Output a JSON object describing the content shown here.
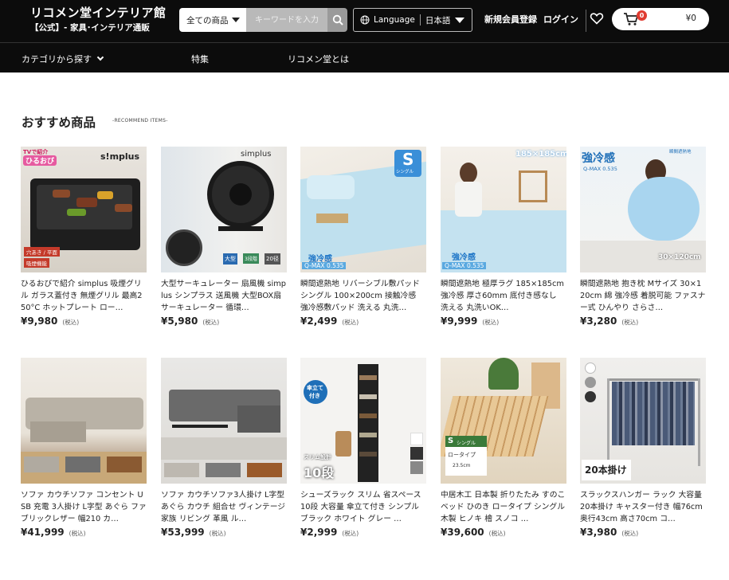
{
  "header": {
    "brand_name": "リコメン堂インテリア館",
    "brand_sub": "【公式】- 家具･インテリア通販",
    "search_category": "全ての商品",
    "search_placeholder": "キーワードを入力",
    "language_label": "Language",
    "language_value": "日本語",
    "register_label": "新規会員登録",
    "login_label": "ログイン",
    "cart_count": "0",
    "cart_amount": "¥0"
  },
  "nav": {
    "categories": "カテゴリから探す",
    "features": "特集",
    "about": "リコメン堂とは"
  },
  "section": {
    "title": "おすすめ商品",
    "subtitle": "-RECOMMEND ITEMS-"
  },
  "tax_label": "(税込)",
  "products": [
    {
      "name": "ひるおびで紹介 simplus 吸煙グリル ガラス蓋付き 無煙グリル 最高250°C ホットプレート ロー…",
      "price": "¥9,980",
      "img_texts": [
        "TVで紹介",
        "ひるおび",
        "s!mplus",
        "穴あき / 平面",
        "吸煙機能"
      ]
    },
    {
      "name": "大型サーキュレーター 扇風機 simplus シンプラス 送風機 大型BOX扇 サーキュレーター 循環…",
      "price": "¥5,980",
      "img_texts": [
        "simplus",
        "大型",
        "3段階",
        "20径"
      ]
    },
    {
      "name": "瞬間遮熱地 リバーシブル敷パッド シングル 100×200cm 接触冷感 強冷感敷パッド 洗える 丸洗…",
      "price": "¥2,499",
      "img_texts": [
        "S",
        "シングル",
        "強冷感",
        "Q-MAX 0.535"
      ]
    },
    {
      "name": "瞬間遮熱地 極厚ラグ 185×185cm 強冷感 厚さ60mm 底付き感なし 洗える 丸洗いOK…",
      "price": "¥9,999",
      "img_texts": [
        "185×185cm",
        "強冷感",
        "Q-MAX 0.535"
      ]
    },
    {
      "name": "瞬間遮熱地 抱き枕 Mサイズ 30×120cm 綿 強冷感 着脱可能 ファスナー式 ひんやり さらさ…",
      "price": "¥3,280",
      "img_texts": [
        "強冷感",
        "Q-MAX 0.535",
        "瞬間遮熱地",
        "30×120cm"
      ]
    },
    {
      "name": "ソファ カウチソファ コンセント USB 充電 3人掛け L字型 あぐら ファブリックレザー 幅210 カ…",
      "price": "¥41,999",
      "img_texts": []
    },
    {
      "name": "ソファ カウチソファ3人掛け L字型 あぐら カウチ 組合せ ヴィンテージ 家族 リビング 革風 ル…",
      "price": "¥53,999",
      "img_texts": []
    },
    {
      "name": "シューズラック スリム 省スペース 10段 大容量 傘立て付き シンプル ブラック ホワイト グレー …",
      "price": "¥2,999",
      "img_texts": [
        "傘立て",
        "付き",
        "スリム設計",
        "10段"
      ]
    },
    {
      "name": "中居木工 日本製 折りたたみ すのこ ベッド ひのき ロータイプ シングル 木製 ヒノキ 檜 スノコ …",
      "price": "¥39,600",
      "img_texts": [
        "S",
        "シングル",
        "ロータイプ",
        "23.5cm"
      ]
    },
    {
      "name": "スラックスハンガー ラック 大容量 20本掛け キャスター付き 幅76cm 奥行43cm 高さ70cm コ…",
      "price": "¥3,980",
      "img_texts": [
        "20本掛け"
      ]
    }
  ],
  "colors": {
    "header_bg": "#0c0c0c",
    "badge": "#e03c31"
  }
}
